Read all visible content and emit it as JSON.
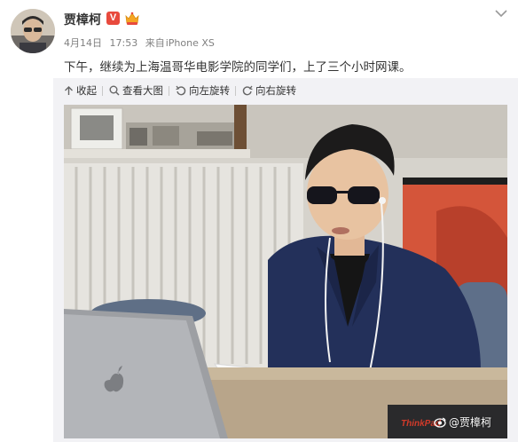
{
  "author": {
    "name": "贾樟柯",
    "verified_badge": "V"
  },
  "meta": {
    "date": "4月14日",
    "time": "17:53",
    "source_prefix": "来自",
    "source_device": "iPhone XS"
  },
  "post": {
    "text": "下午，继续为上海温哥华电影学院的同学们，上了三个小时网课。"
  },
  "toolbar": {
    "collapse_label": "收起",
    "view_large_label": "查看大图",
    "rotate_left_label": "向左旋转",
    "rotate_right_label": "向右旋转"
  },
  "image": {
    "watermark": "@贾樟柯",
    "laptop_sticker": "ThinkPad"
  },
  "colors": {
    "accent": "#e84a3d",
    "meta_text": "#808080",
    "toolbar_bg": "#f2f2f5"
  },
  "icons": [
    "avatar-photo",
    "verified-icon",
    "crown-badge-icon",
    "chevron-down-icon",
    "arrow-up-icon",
    "search-icon",
    "rotate-left-icon",
    "rotate-right-icon",
    "weibo-eye-icon"
  ]
}
